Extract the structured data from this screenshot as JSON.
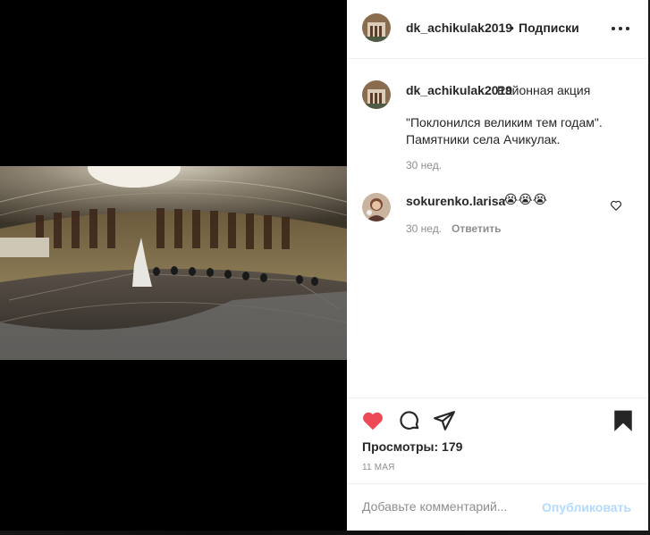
{
  "header": {
    "username": "dk_achikulak2019",
    "separator": "•",
    "follow_label": "Подписки",
    "more_icon": "more-horizontal-icon"
  },
  "caption": {
    "username": "dk_achikulak2019",
    "text": "Районная акция",
    "paragraph": "\"Поклонился великим тем годам\". Памятники села Ачикулак.",
    "time": "30 нед."
  },
  "comments": [
    {
      "username": "sokurenko.larisa",
      "text": "😭😭😭",
      "time": "30 нед.",
      "reply_label": "Ответить"
    }
  ],
  "actions": {
    "like_icon": "heart-filled-icon",
    "like_color": "#ed4956",
    "comment_icon": "comment-icon",
    "share_icon": "share-icon",
    "save_icon": "bookmark-filled-icon",
    "views_label": "Просмотры: 179",
    "date": "11 мая"
  },
  "add_comment": {
    "placeholder": "Добавьте комментарий...",
    "post_label": "Опубликовать",
    "post_color": "#b3dbff"
  }
}
